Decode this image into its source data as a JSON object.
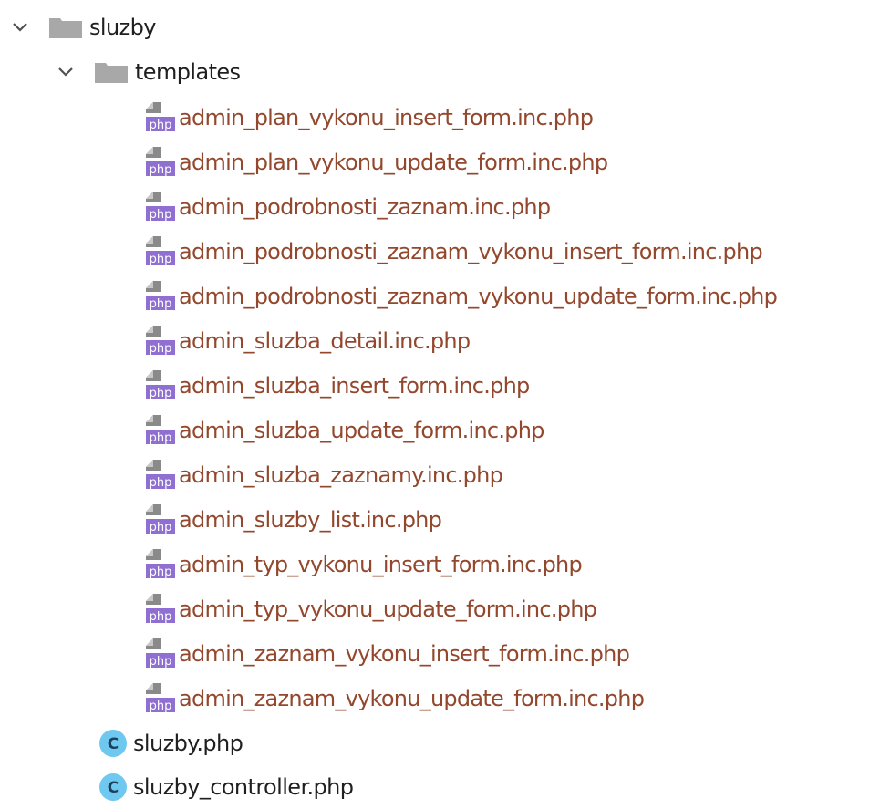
{
  "tree": {
    "root": {
      "label": "sluzby",
      "icon": "folder-icon",
      "expanded": true
    },
    "templates_folder": {
      "label": "templates",
      "icon": "folder-icon",
      "expanded": true
    },
    "template_files": [
      "admin_plan_vykonu_insert_form.inc.php",
      "admin_plan_vykonu_update_form.inc.php",
      "admin_podrobnosti_zaznam.inc.php",
      "admin_podrobnosti_zaznam_vykonu_insert_form.inc.php",
      "admin_podrobnosti_zaznam_vykonu_update_form.inc.php",
      "admin_sluzba_detail.inc.php",
      "admin_sluzba_insert_form.inc.php",
      "admin_sluzba_update_form.inc.php",
      "admin_sluzba_zaznamy.inc.php",
      "admin_sluzby_list.inc.php",
      "admin_typ_vykonu_insert_form.inc.php",
      "admin_typ_vykonu_update_form.inc.php",
      "admin_zaznam_vykonu_insert_form.inc.php",
      "admin_zaznam_vykonu_update_form.inc.php"
    ],
    "php_icon_text": "php",
    "class_icon_text": "C",
    "class_files": [
      "sluzby.php",
      "sluzby_controller.php"
    ]
  },
  "colors": {
    "folder": "#a8a8a8",
    "chevron": "#505050",
    "file_text": "#93482d",
    "php_badge": "#8f6fd1",
    "class_icon": "#6ec8ef"
  }
}
